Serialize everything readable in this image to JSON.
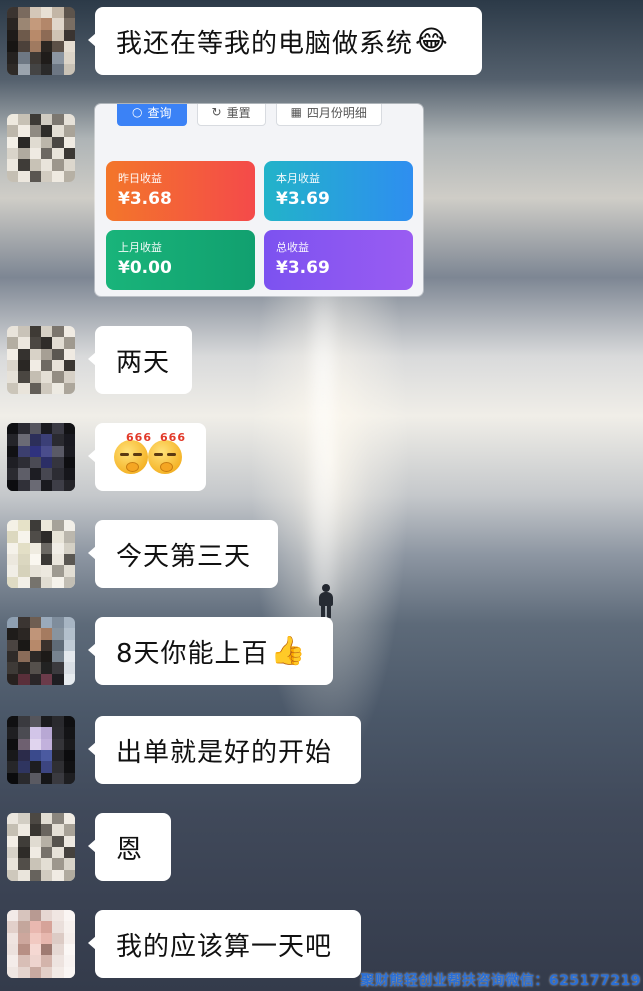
{
  "messages": [
    {
      "text": "我还在等我的电脑做系统",
      "emoji": "😂"
    },
    {
      "text": "两天"
    },
    {
      "text": "",
      "emoji_desc": "666-thinking-face x2"
    },
    {
      "text": "今天第三天"
    },
    {
      "text": "8天你能上百",
      "emoji": "👍"
    },
    {
      "text": "出单就是好的开始"
    },
    {
      "text": "恩"
    },
    {
      "text": "我的应该算一天吧"
    }
  ],
  "image_message": {
    "buttons": {
      "query": "查询",
      "reset": "重置",
      "detail": "四月份明细"
    },
    "cards": [
      {
        "label": "昨日收益",
        "value": "¥3.68",
        "color": "#f3762a"
      },
      {
        "label": "本月收益",
        "value": "¥3.69",
        "color": "#2e8ef0"
      },
      {
        "label": "上月收益",
        "value": "¥0.00",
        "color": "#19b47a"
      },
      {
        "label": "总收益",
        "value": "¥3.69",
        "color": "#7c52f0"
      }
    ]
  },
  "emoji_number": "666",
  "watermark": "聚财熊轻创业帮扶咨询微信：625177219"
}
